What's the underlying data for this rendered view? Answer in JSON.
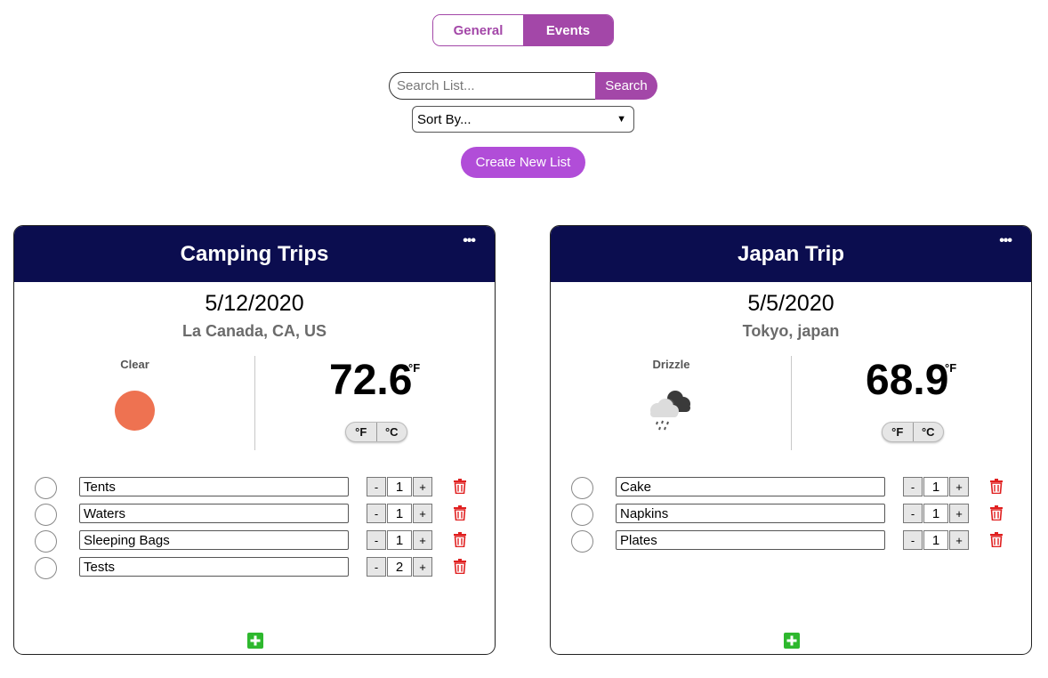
{
  "tabs": [
    {
      "label": "General"
    },
    {
      "label": "Events"
    }
  ],
  "search": {
    "placeholder": "Search List...",
    "button_label": "Search"
  },
  "sort": {
    "selected": "Sort By..."
  },
  "create_button": {
    "label": "Create New List"
  },
  "colors": {
    "accent": "#a347a8",
    "create": "#b14dd8",
    "header": "#0b0d4f",
    "sun": "#ee7251",
    "trash": "#e02020",
    "add": "#2eb82e"
  },
  "cards": [
    {
      "title": "Camping Trips",
      "date": "5/12/2020",
      "location": "La Canada, CA, US",
      "weather": {
        "description": "Clear",
        "icon": "sun-icon",
        "temp": "72.6",
        "unit": "°F"
      },
      "units": [
        "°F",
        "°C"
      ],
      "items": [
        {
          "name": "Tents",
          "qty": "1"
        },
        {
          "name": "Waters",
          "qty": "1"
        },
        {
          "name": "Sleeping Bags",
          "qty": "1"
        },
        {
          "name": "Tests",
          "qty": "2"
        }
      ]
    },
    {
      "title": "Japan Trip",
      "date": "5/5/2020",
      "location": "Tokyo, japan",
      "weather": {
        "description": "Drizzle",
        "icon": "drizzle-cloud-icon",
        "temp": "68.9",
        "unit": "°F"
      },
      "units": [
        "°F",
        "°C"
      ],
      "items": [
        {
          "name": "Cake",
          "qty": "1"
        },
        {
          "name": "Napkins",
          "qty": "1"
        },
        {
          "name": "Plates",
          "qty": "1"
        }
      ]
    }
  ],
  "stepper": {
    "minus": "-",
    "plus": "+"
  },
  "menu_label": "•••"
}
